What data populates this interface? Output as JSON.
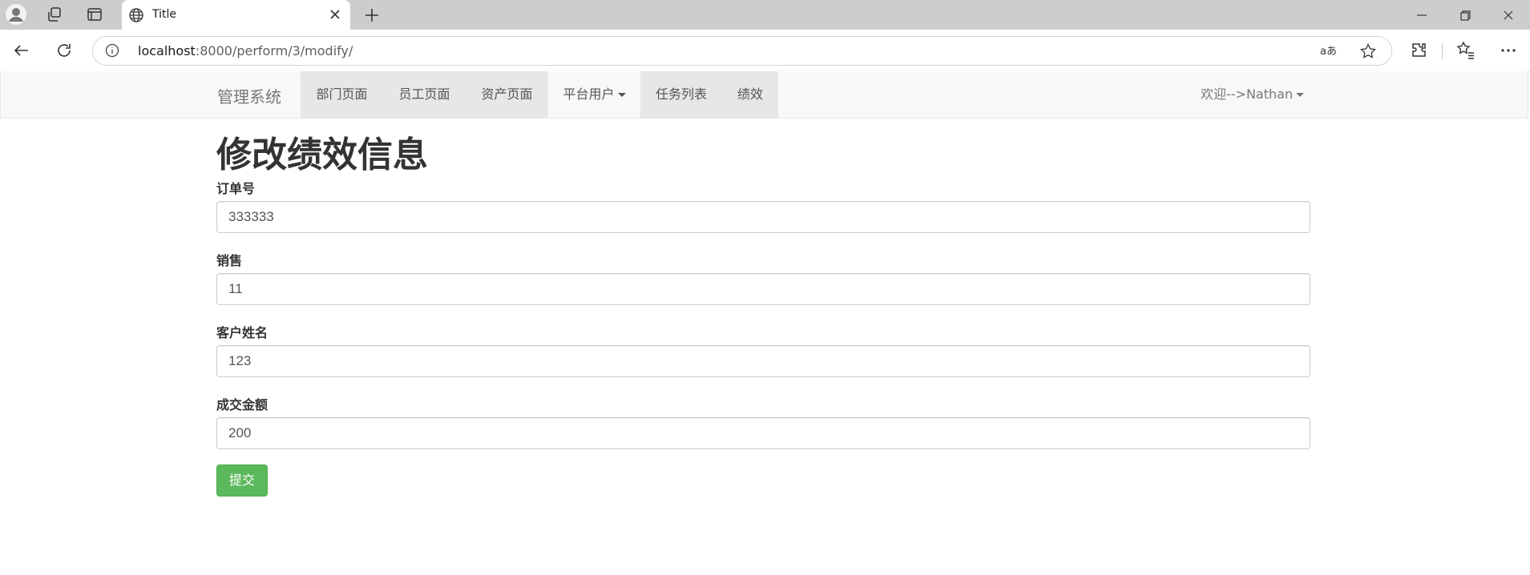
{
  "browser": {
    "tab_title": "Title",
    "url_host": "localhost",
    "url_rest": ":8000/perform/3/modify/"
  },
  "navbar": {
    "brand": "管理系统",
    "items": [
      {
        "label": "部门页面",
        "active": true
      },
      {
        "label": "员工页面",
        "active": true
      },
      {
        "label": "资产页面",
        "active": true
      },
      {
        "label": "平台用户",
        "active": false,
        "dropdown": true
      },
      {
        "label": "任务列表",
        "active": true
      },
      {
        "label": "绩效",
        "active": true
      }
    ],
    "welcome": "欢迎-->Nathan"
  },
  "form": {
    "title": "修改绩效信息",
    "fields": [
      {
        "label": "订单号",
        "value": "333333"
      },
      {
        "label": "销售",
        "value": "11"
      },
      {
        "label": "客户姓名",
        "value": "123"
      },
      {
        "label": "成交金额",
        "value": "200"
      }
    ],
    "submit_label": "提交"
  },
  "colors": {
    "submit": "#5cb85c",
    "navbar_bg": "#f8f8f8",
    "nav_active_bg": "#e7e7e7",
    "tabbar_bg": "#cdcdcd"
  }
}
